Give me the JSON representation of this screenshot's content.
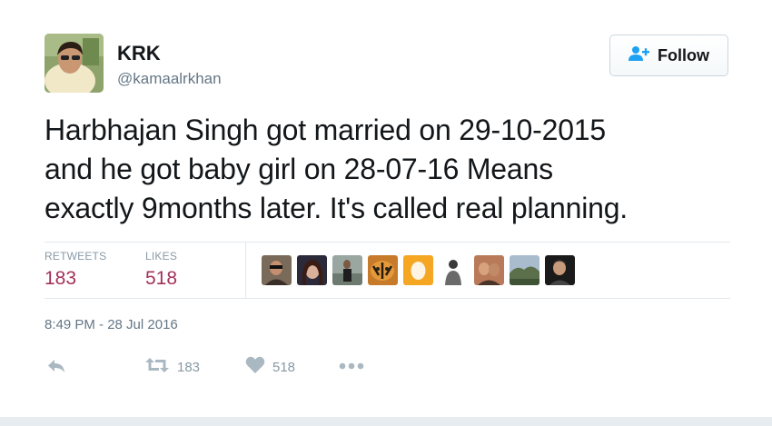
{
  "user": {
    "display_name": "KRK",
    "handle": "@kamaalrkhan"
  },
  "follow_button": {
    "label": "Follow",
    "icon": "follow-person-plus-icon"
  },
  "tweet": {
    "text_lines": [
      "Harbhajan Singh got married on 29-10-2015",
      "and he got baby girl on 28-07-16 Means",
      "exactly 9months later. It's called real planning."
    ],
    "timestamp": "8:49 PM - 28 Jul 2016"
  },
  "stats": {
    "retweets_label": "RETWEETS",
    "retweets_count": "183",
    "likes_label": "LIKES",
    "likes_count": "518"
  },
  "actions": {
    "reply_icon": "reply-icon",
    "retweet_icon": "retweet-icon",
    "retweet_count": "183",
    "like_icon": "heart-icon",
    "like_count": "518",
    "more_icon": "more-dots-icon"
  },
  "colors": {
    "count_accent": "#a3315a",
    "muted": "#657786",
    "light_muted": "#8899a6",
    "follow_icon": "#1da1f2",
    "divider": "#e1e8ed"
  }
}
